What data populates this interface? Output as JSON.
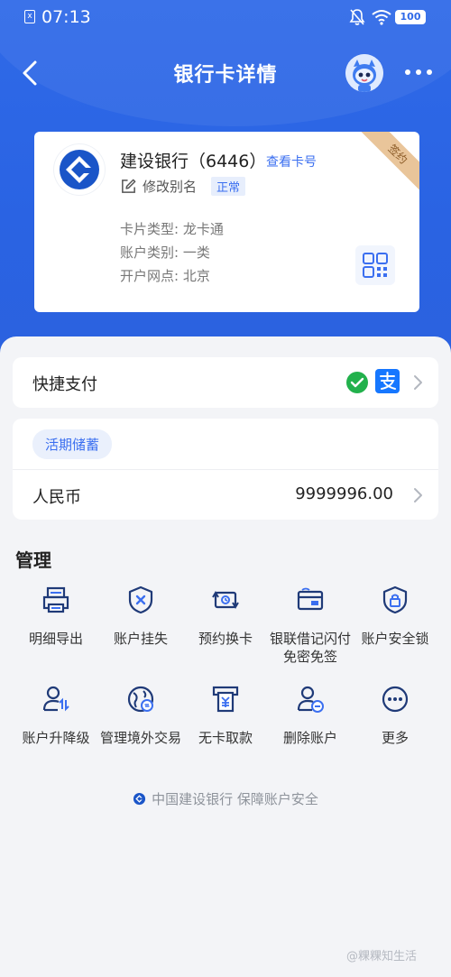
{
  "status_bar": {
    "sim": "x",
    "time": "07:13",
    "battery": "100"
  },
  "nav": {
    "title": "银行卡详情"
  },
  "card": {
    "bank_name": "建设银行（6446）",
    "view_card_no": "查看卡号",
    "edit_alias": "修改别名",
    "status": "正常",
    "card_type": "卡片类型: 龙卡通",
    "account_class": "账户类别: 一类",
    "branch": "开户网点: 北京",
    "ribbon": "签约"
  },
  "quick_pay": {
    "title": "快捷支付"
  },
  "savings": {
    "tag": "活期储蓄",
    "currency": "人民币",
    "balance": "9999996.00"
  },
  "manage": {
    "title": "管理",
    "items": [
      {
        "label": "明细导出",
        "icon": "printer-icon"
      },
      {
        "label": "账户挂失",
        "icon": "shield-x-icon"
      },
      {
        "label": "预约换卡",
        "icon": "card-swap-icon"
      },
      {
        "label": "银联借记闪付免密免签",
        "icon": "unionpay-card-icon"
      },
      {
        "label": "账户安全锁",
        "icon": "shield-lock-icon"
      },
      {
        "label": "账户升降级",
        "icon": "user-updown-icon"
      },
      {
        "label": "管理境外交易",
        "icon": "globe-swap-icon"
      },
      {
        "label": "无卡取款",
        "icon": "atm-yuan-icon"
      },
      {
        "label": "删除账户",
        "icon": "user-minus-icon"
      },
      {
        "label": "更多",
        "icon": "more-circle-icon"
      }
    ]
  },
  "footer": {
    "text": "中国建设银行 保障账户安全"
  },
  "watermark": "@粿粿知生活",
  "colors": {
    "primary": "#2f6ae8",
    "accent_text": "#3b6ff0",
    "ribbon": "#e9c59a"
  }
}
